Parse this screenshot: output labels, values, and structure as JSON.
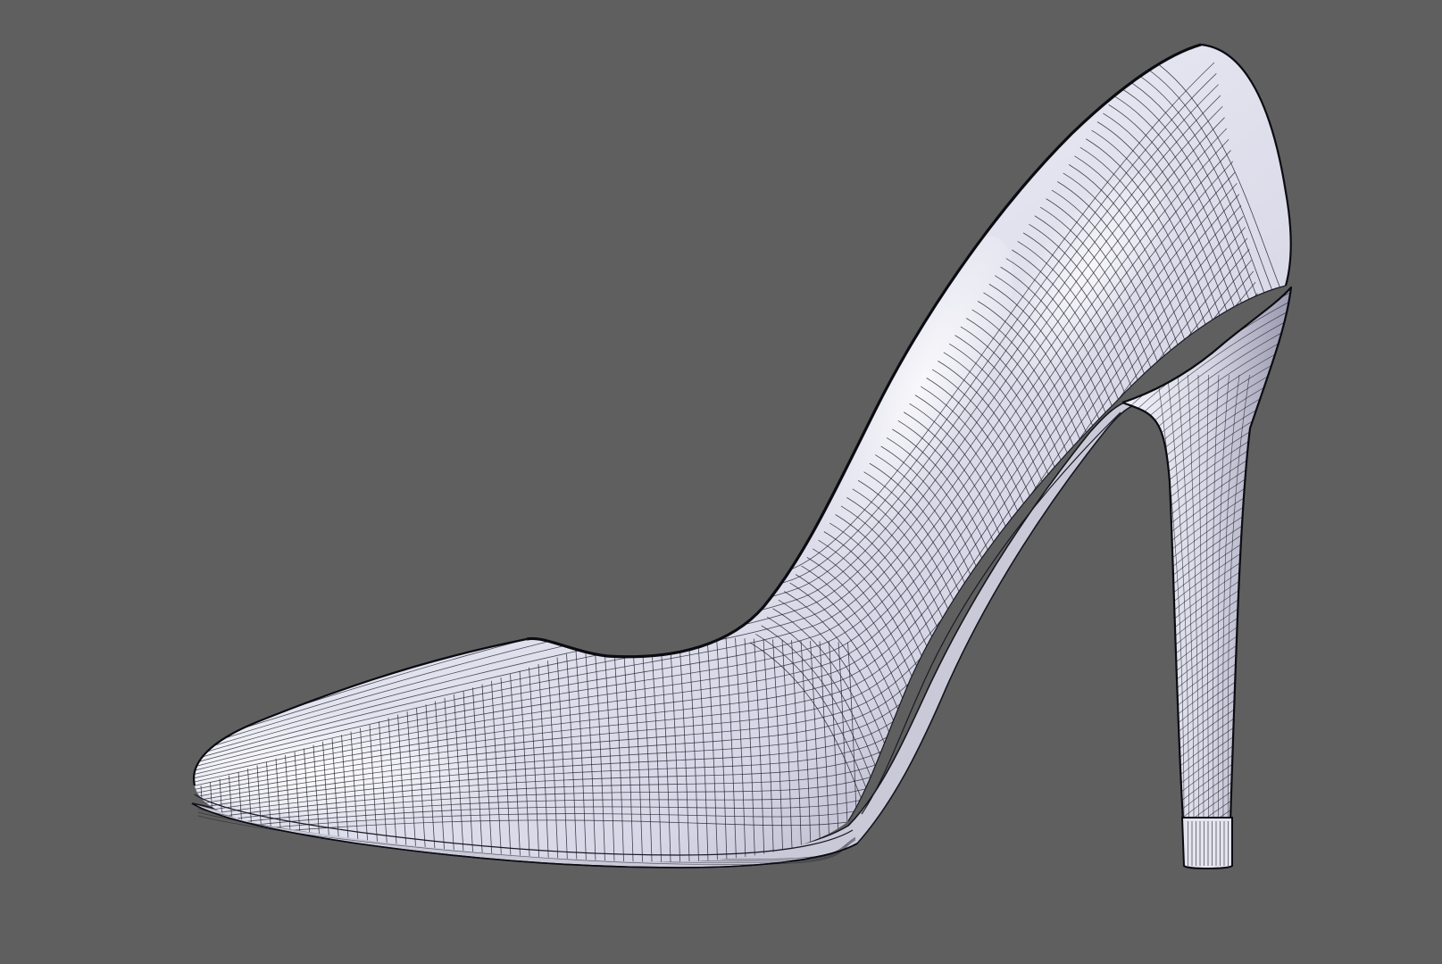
{
  "viewport": {
    "background": "#5f5f5f",
    "mode": "wireframe-on-shaded"
  },
  "model": {
    "type": "high-heel pump shoe",
    "shade_light": "#ffffff",
    "shade_mid": "#d6d6e6",
    "shade_dark": "#8e8ea4",
    "wire_color": "#1c1c26",
    "outline_color": "#0b0b12"
  }
}
